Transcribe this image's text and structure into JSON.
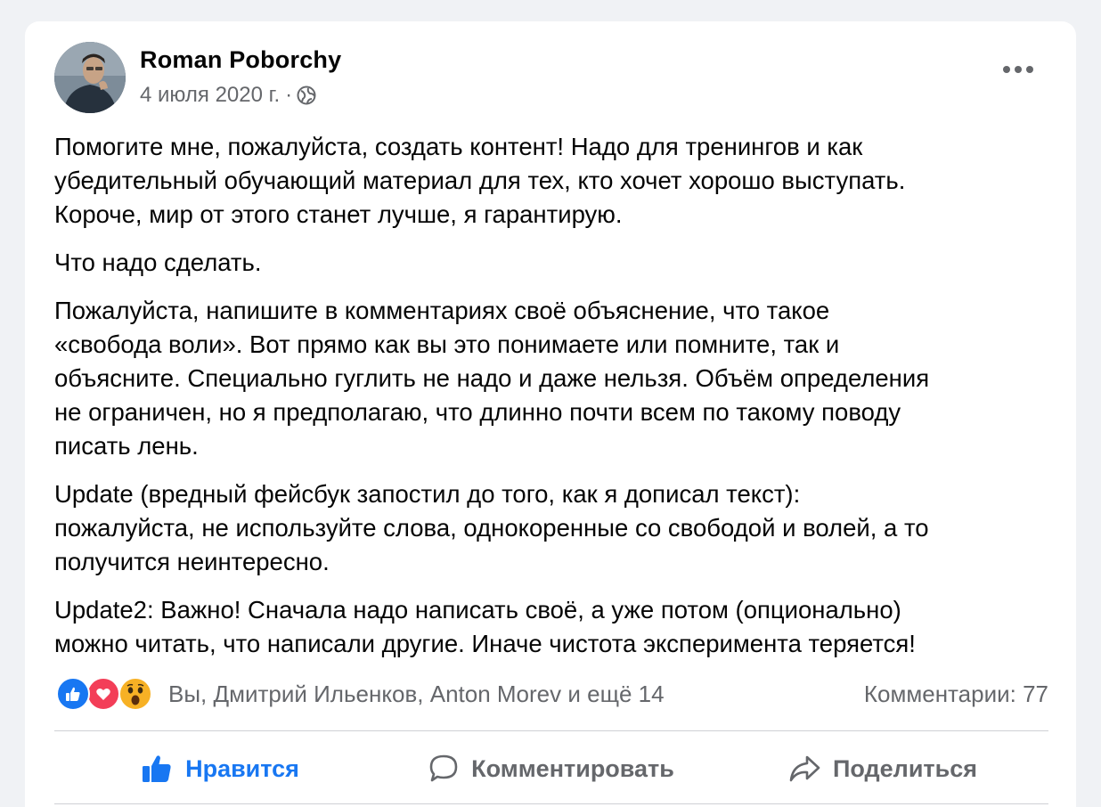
{
  "post": {
    "author": "Roman Poborchy",
    "date": "4 июля 2020 г.",
    "separator": "·",
    "privacy_icon": "globe-icon",
    "paragraphs": [
      "Помогите мне, пожалуйста, создать контент! Надо для тренингов и как\nубедительный обучающий материал для тех, кто хочет хорошо выступать.\nКороче, мир от этого станет лучше, я гарантирую.",
      "Что надо сделать.",
      "Пожалуйста, напишите в комментариях своё объяснение, что такое\n«свобода воли».  Вот прямо как вы это понимаете или помните, так и\nобъясните. Специально гуглить не надо и даже нельзя. Объём определения\nне ограничен, но я предполагаю, что длинно почти всем по такому поводу\nписать лень.",
      "Update (вредный фейсбук запостил до того, как я дописал текст):\nпожалуйста, не используйте слова, однокоренные со свободой и волей, а то\nполучится неинтересно.",
      "Update2: Важно! Сначала надо написать своё, а уже потом (опционально)\nможно читать, что написали другие. Иначе чистота эксперимента теряется!"
    ]
  },
  "reactions": {
    "icons": [
      "like-icon",
      "love-icon",
      "wow-icon"
    ],
    "names": "Вы, Дмитрий Ильенков, Anton Morev и ещё 14",
    "comments": "Комментарии: 77"
  },
  "actions": {
    "like": "Нравится",
    "comment": "Комментировать",
    "share": "Поделиться"
  },
  "colors": {
    "accent": "#1877f2",
    "love": "#f33e58",
    "wow": "#f7b125",
    "secondary_text": "#65676b",
    "background": "#f0f2f5"
  }
}
